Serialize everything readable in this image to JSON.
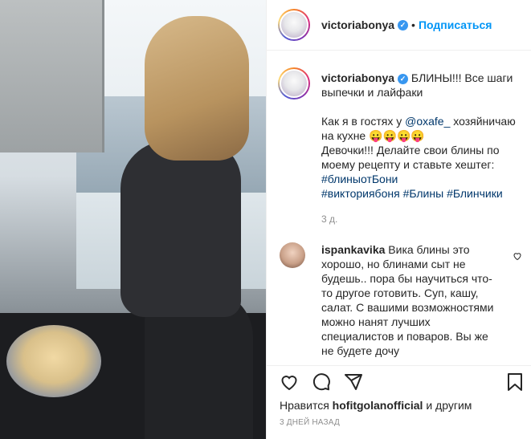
{
  "post": {
    "author": "victoriabonya",
    "follow_label": "Подписаться",
    "separator": "•"
  },
  "caption": {
    "username": "victoriabonya",
    "line1": "БЛИНЫ!!! Все шаги выпечки и лайфаки",
    "line2_prefix": "Как я в гостях у ",
    "mention": "@oxafe_",
    "line2_suffix": " хозяйничаю на кухне 😛😛😛😛",
    "line3": "Девочки!!! Делайте свои блины по моему рецепту и ставьте хештег:",
    "hashtag1": "#блиныотБони",
    "hashtag2": "#викториябоня",
    "hashtag3": "#Блины",
    "hashtag4": "#Блинчики",
    "time": "3 д."
  },
  "comment": {
    "username": "ispankavika",
    "text": "Вика блины это хорошо, но блинами сыт не будешь.. пора бы научиться что-то другое готовить. Суп, кашу, салат. С вашими возможностями можно нанят лучших специалистов и поваров. Вы же не будете дочу"
  },
  "likes": {
    "prefix": "Нравится ",
    "user": "hofitgolanofficial",
    "suffix": " и другим"
  },
  "date": "3 ДНЕЙ НАЗАД",
  "icons": {
    "verified": "✓"
  },
  "colors": {
    "follow": "#0095f6",
    "verified": "#3897f0",
    "link": "#00376b",
    "muted": "#8e8e8e"
  }
}
